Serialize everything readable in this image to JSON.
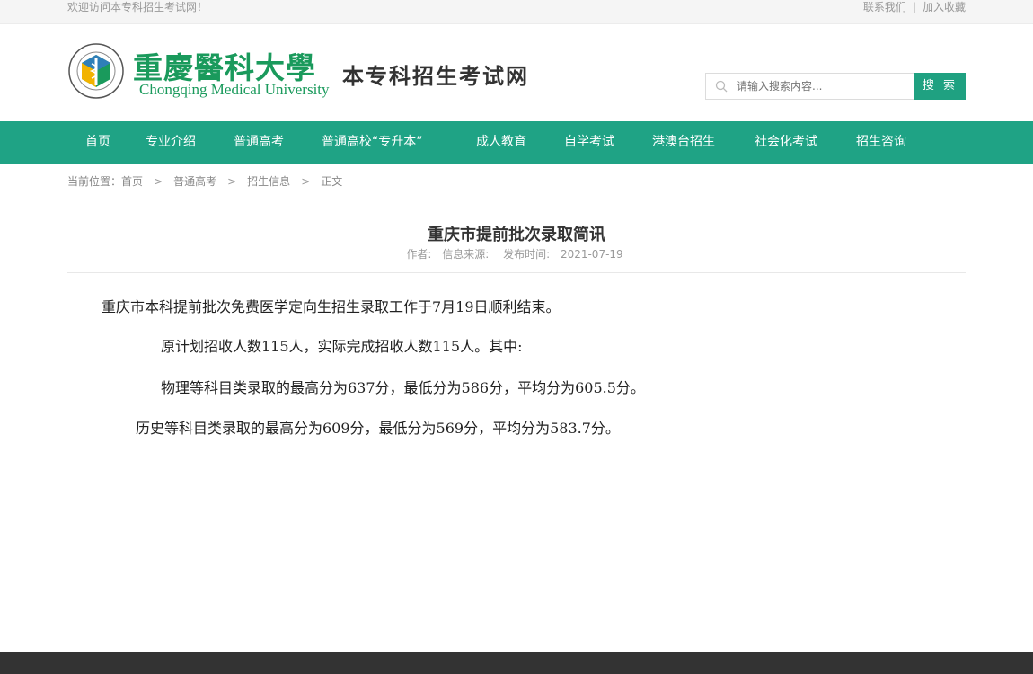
{
  "topbar": {
    "welcome": "欢迎访问本专科招生考试网！",
    "contact": "联系我们",
    "separator": "|",
    "favorite": "加入收藏"
  },
  "header": {
    "university_cn": "重慶醫科大學",
    "university_en": "Chongqing Medical University",
    "site_title": "本专科招生考试网",
    "search_placeholder": "请输入搜索内容...",
    "search_button": "搜 索"
  },
  "nav": {
    "items": [
      {
        "label": "首页"
      },
      {
        "label": "专业介绍"
      },
      {
        "label": "普通高考"
      },
      {
        "label": "普通高校“专升本”"
      },
      {
        "label": "成人教育"
      },
      {
        "label": "自学考试"
      },
      {
        "label": "港澳台招生"
      },
      {
        "label": "社会化考试"
      },
      {
        "label": "招生咨询"
      }
    ]
  },
  "breadcrumb": {
    "prefix": "当前位置：",
    "items": [
      "首页",
      "普通高考",
      "招生信息",
      "正文"
    ],
    "arrow": ">"
  },
  "article": {
    "title": "重庆市提前批次录取简讯",
    "author_label": "作者:",
    "source_label": "信息来源:",
    "date_label": "发布时间:",
    "date": "2021-07-19",
    "paragraphs": [
      "重庆市本科提前批次免费医学定向生招生录取工作于7月19日顺利结束。",
      "原计划招收人数115人，实际完成招收人数115人。其中:",
      "物理等科目类录取的最高分为637分，最低分为586分，平均分为605.5分。",
      "历史等科目类录取的最高分为609分，最低分为569分，平均分为583.7分。"
    ]
  },
  "colors": {
    "brand_green": "#1fa385",
    "logo_green": "#1a9a5c",
    "footer": "#333333"
  }
}
